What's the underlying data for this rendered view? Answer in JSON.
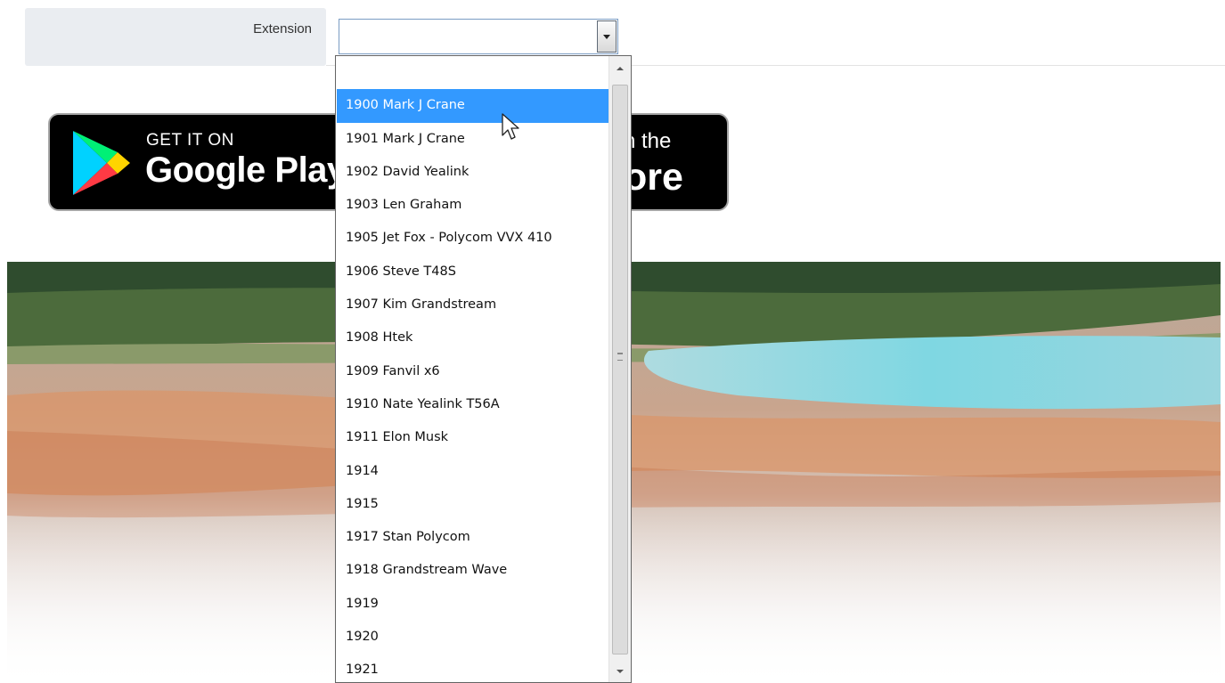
{
  "form": {
    "extension_label": "Extension",
    "extension_value": ""
  },
  "badges": {
    "google_play": {
      "small_text": "GET IT ON",
      "big_text": "Google Play"
    },
    "app_store": {
      "small_text": "n the",
      "big_text": "ore"
    }
  },
  "dropdown": {
    "selected_index": 1,
    "options": [
      "",
      "1900 Mark J Crane",
      "1901 Mark J Crane",
      "1902 David Yealink",
      "1903 Len Graham",
      "1905 Jet Fox - Polycom VVX 410",
      "1906 Steve T48S",
      "1907 Kim Grandstream",
      "1908 Htek",
      "1909 Fanvil x6",
      "1910 Nate Yealink T56A",
      "1911 Elon Musk",
      "1914",
      "1915",
      "1917 Stan Polycom",
      "1918 Grandstream Wave",
      "1919",
      "1920",
      "1921"
    ]
  },
  "colors": {
    "selection": "#3399ff",
    "label_background": "#eaedf1",
    "badge_background": "#000000"
  },
  "icons": {
    "play_logo": "google-play-triangle-icon",
    "select_arrow": "chevron-down-icon",
    "cursor": "mouse-pointer-icon"
  }
}
